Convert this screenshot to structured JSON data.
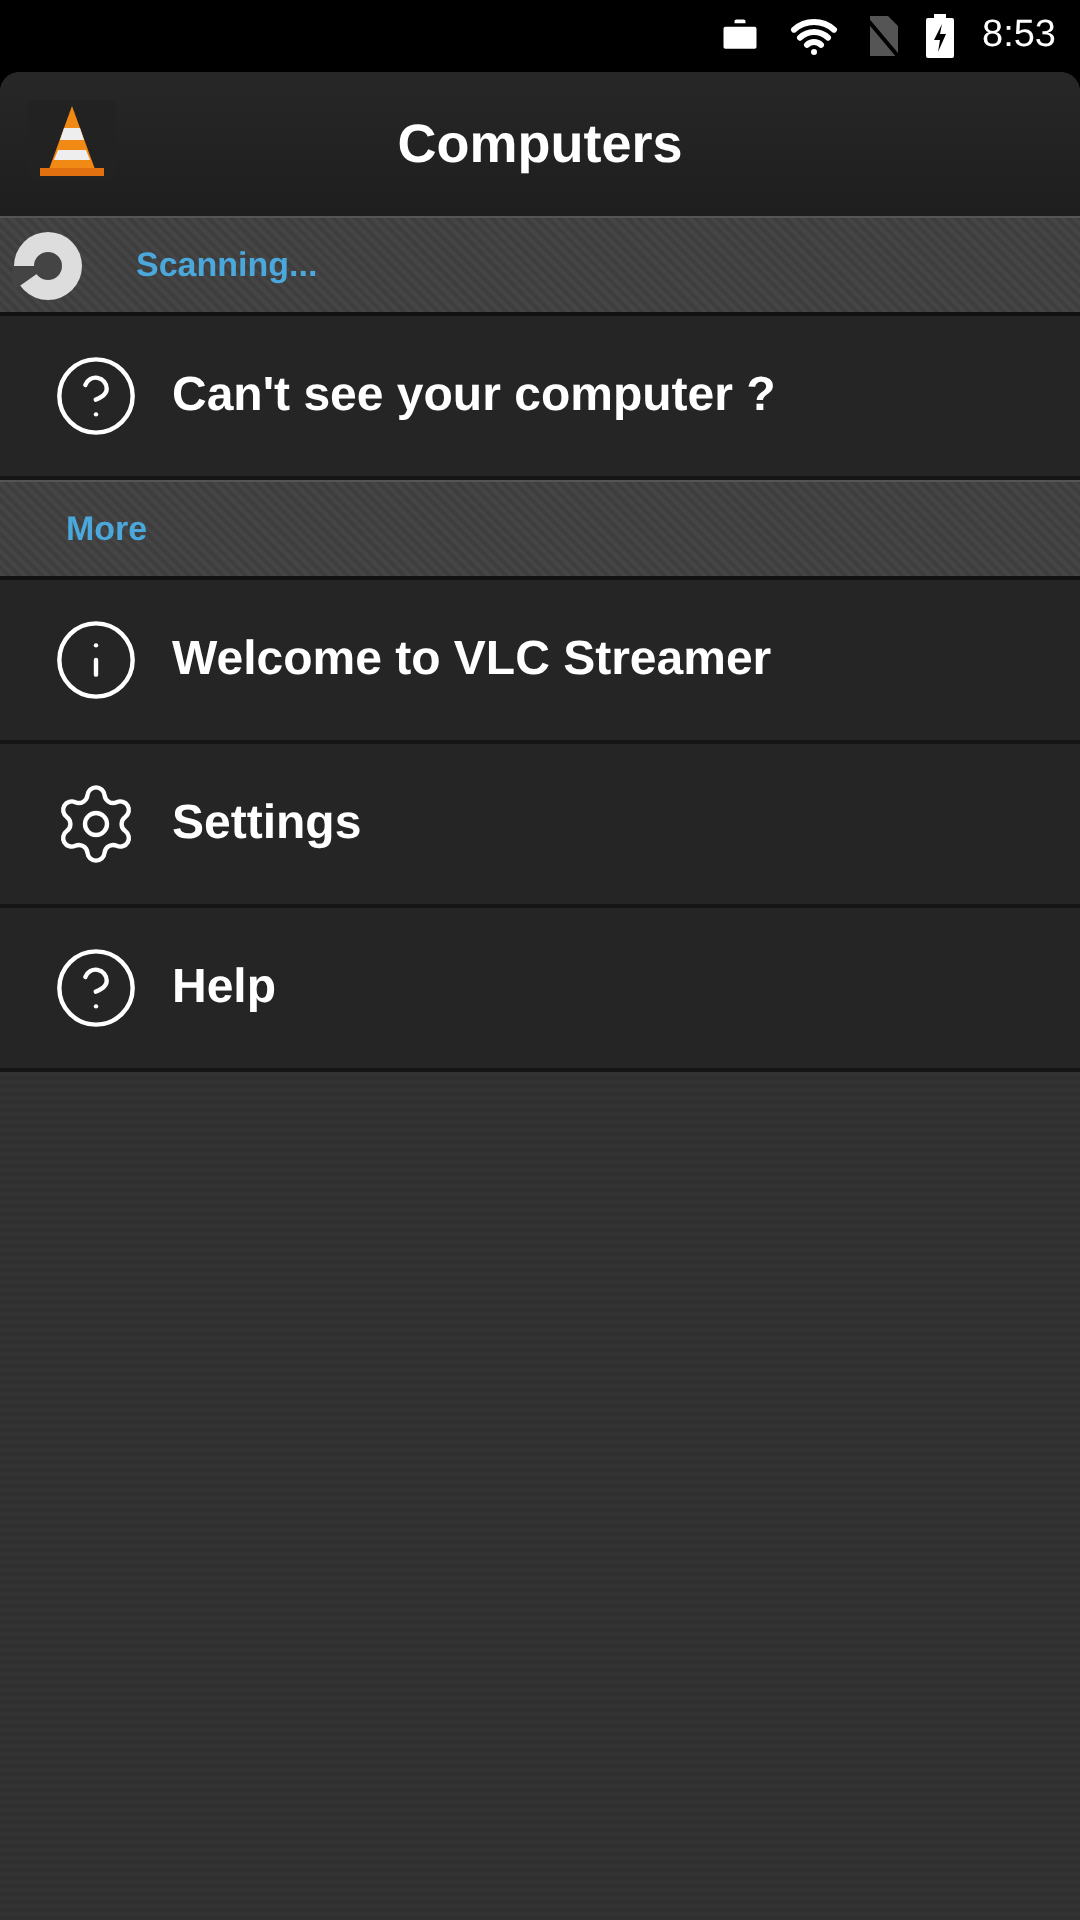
{
  "status_bar": {
    "time": "8:53"
  },
  "header": {
    "title": "Computers"
  },
  "scanning": {
    "label": "Scanning..."
  },
  "sections": [
    {
      "items": [
        {
          "kind": "help",
          "label": "Can't see your computer ?"
        }
      ]
    },
    {
      "title": "More",
      "items": [
        {
          "kind": "info",
          "label": "Welcome to VLC Streamer"
        },
        {
          "kind": "settings",
          "label": "Settings"
        },
        {
          "kind": "help",
          "label": "Help"
        }
      ]
    }
  ]
}
